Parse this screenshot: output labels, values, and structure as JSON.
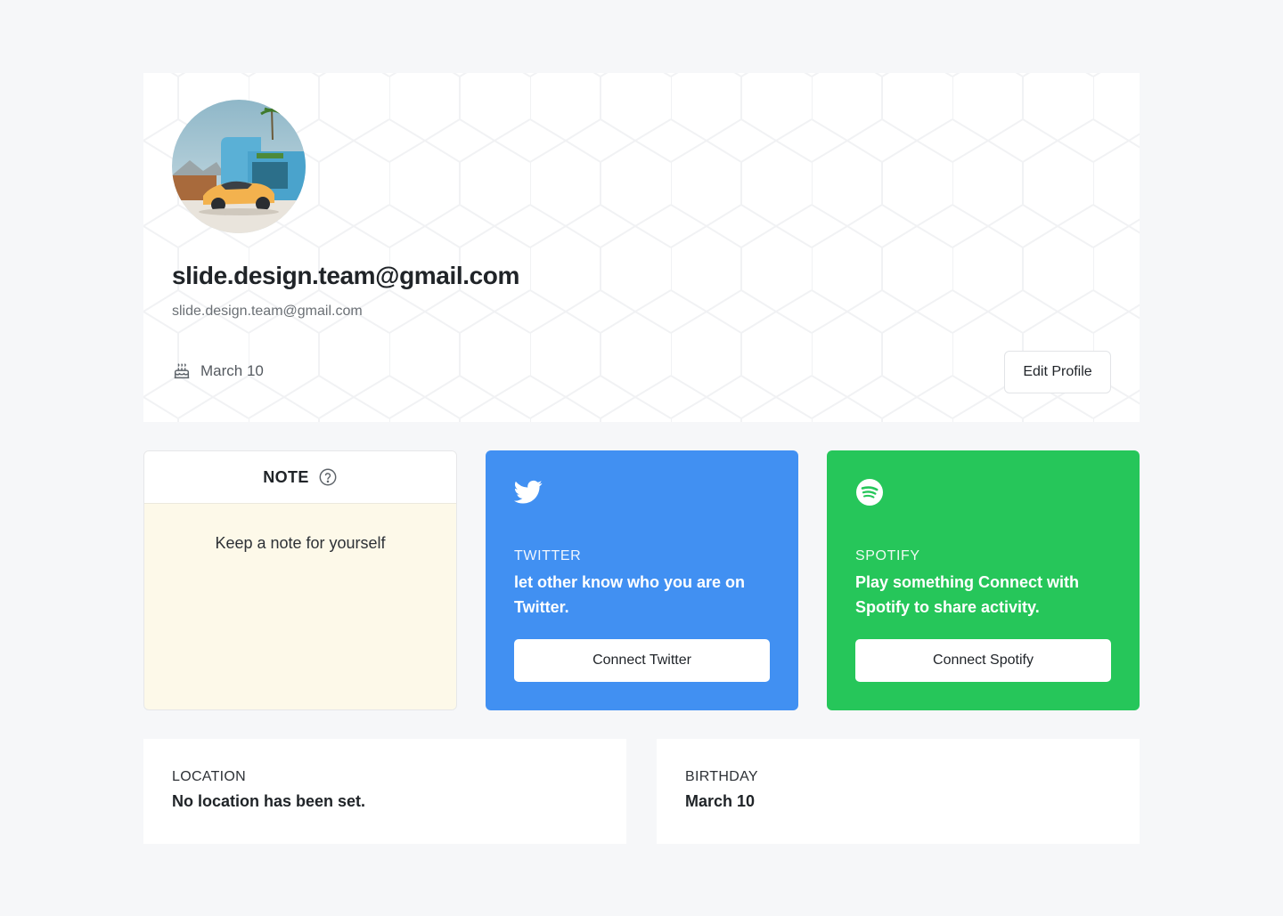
{
  "profile": {
    "display_name": "slide.design.team@gmail.com",
    "email": "slide.design.team@gmail.com",
    "birthday_label": "March 10",
    "birthday_icon": "cake-icon",
    "edit_button_label": "Edit Profile",
    "avatar_description": "avatar-photo"
  },
  "note": {
    "title": "NOTE",
    "help_icon": "help-circle-icon",
    "placeholder": "Keep a note for yourself"
  },
  "twitter": {
    "icon": "twitter-icon",
    "kicker": "TWITTER",
    "description": "let other know who you are on Twitter.",
    "button_label": "Connect Twitter",
    "color": "#4190f2"
  },
  "spotify": {
    "icon": "spotify-icon",
    "kicker": "SPOTIFY",
    "description": "Play something Connect with Spotify to share activity.",
    "button_label": "Connect Spotify",
    "color": "#26c65a"
  },
  "location": {
    "label": "LOCATION",
    "value": "No location has been set."
  },
  "birthday": {
    "label": "BIRTHDAY",
    "value": "March 10"
  }
}
